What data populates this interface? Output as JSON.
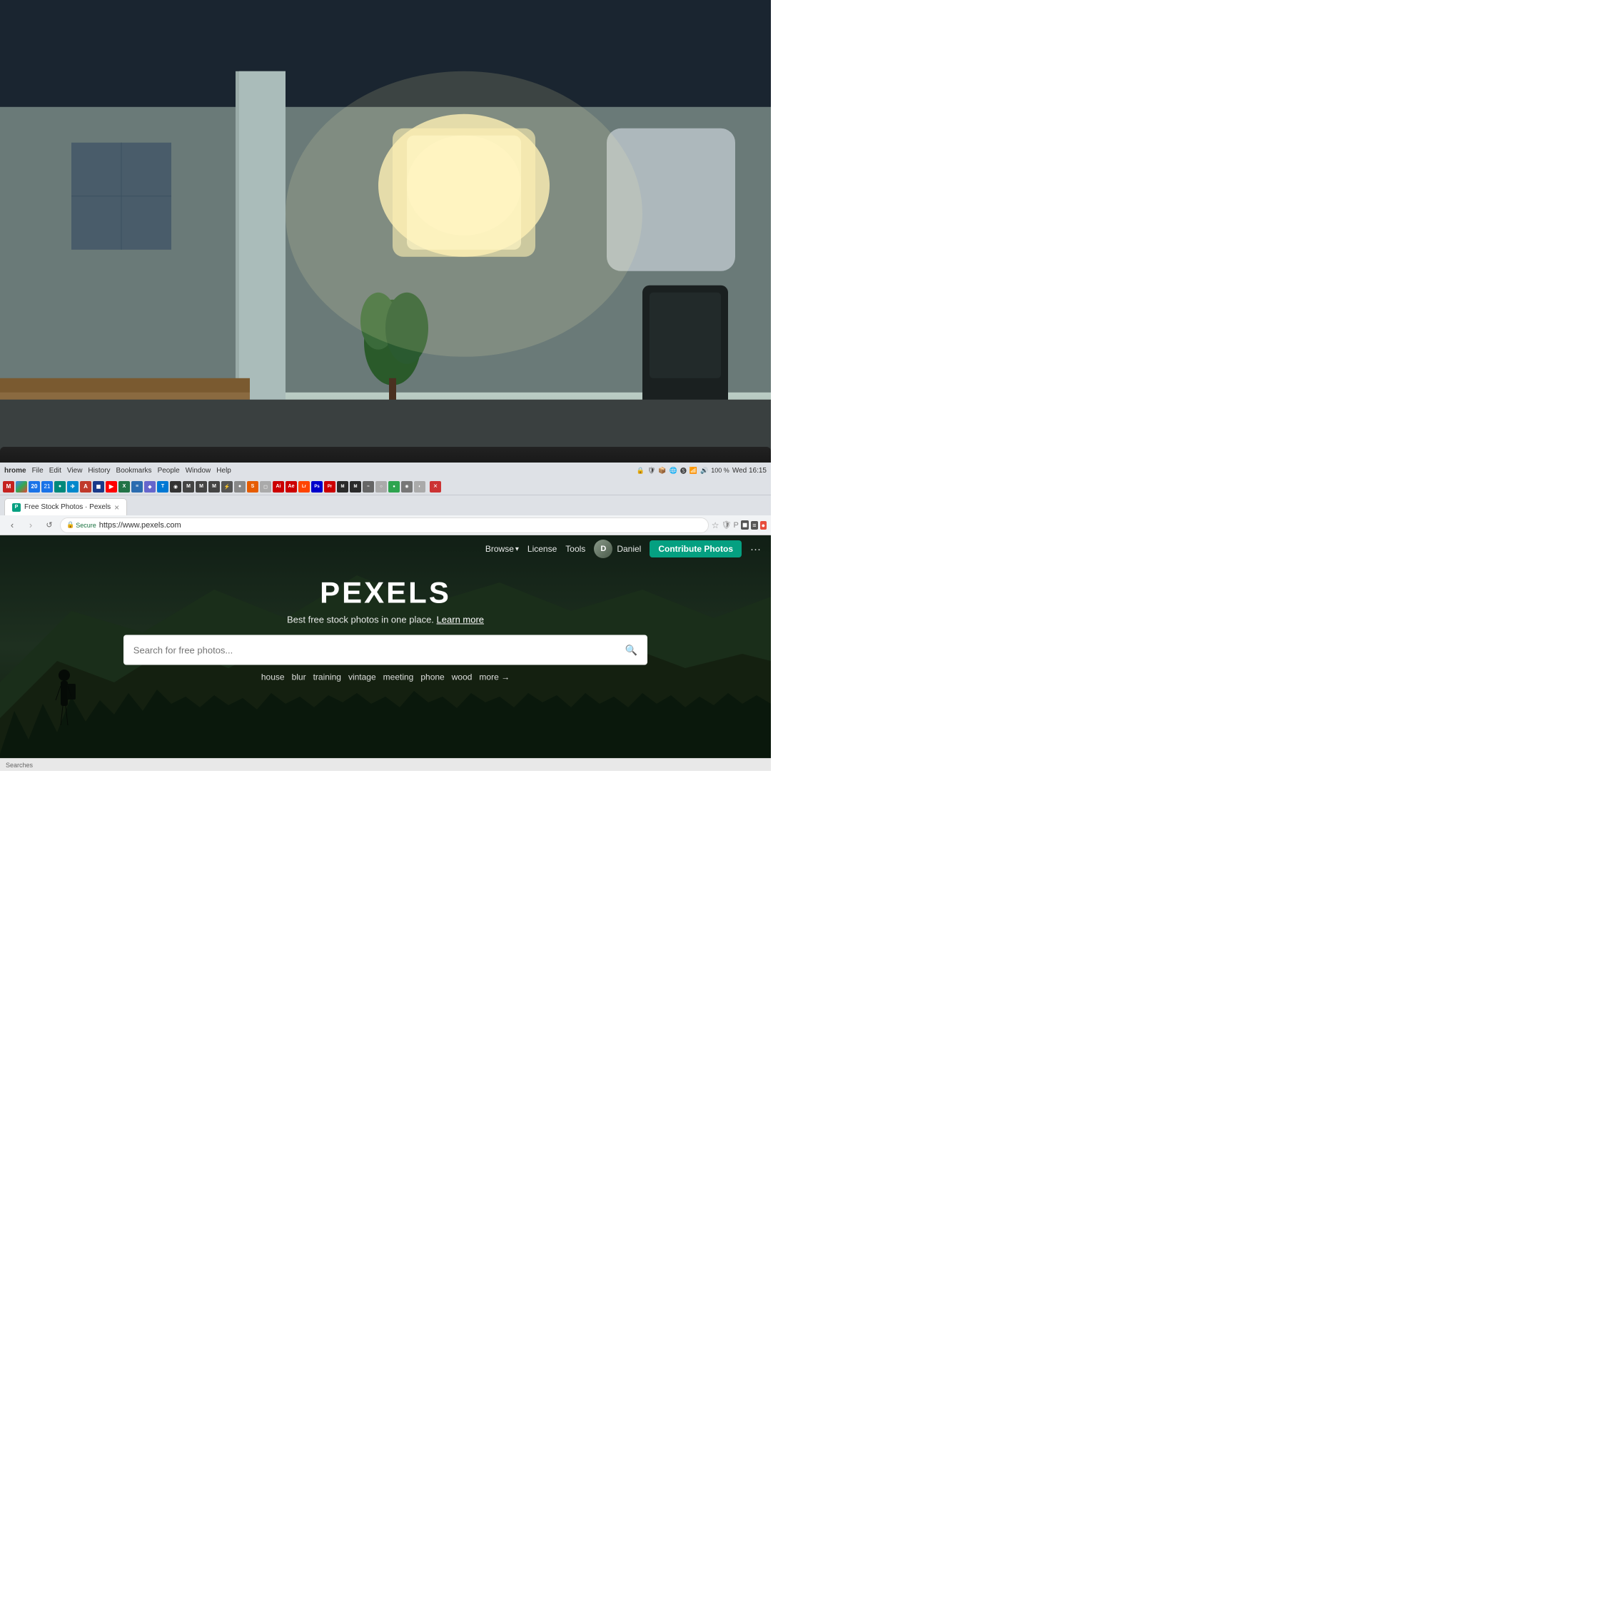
{
  "photo": {
    "alt": "Office workspace with blurred background"
  },
  "browser": {
    "menu": {
      "items": [
        "hrome",
        "File",
        "Edit",
        "View",
        "History",
        "Bookmarks",
        "People",
        "Window",
        "Help"
      ]
    },
    "system": {
      "battery": "100 %",
      "time": "Wed 16:15"
    },
    "tab": {
      "title": "Free Stock Photos · Pexels",
      "favicon": "P"
    },
    "address": {
      "secure_label": "Secure",
      "url": "https://www.pexels.com"
    },
    "close_icon": "×"
  },
  "pexels": {
    "nav": {
      "browse_label": "Browse",
      "license_label": "License",
      "tools_label": "Tools",
      "user_name": "Daniel",
      "contribute_label": "Contribute Photos",
      "more_icon": "···"
    },
    "hero": {
      "brand": "PEXELS",
      "subtitle": "Best free stock photos in one place.",
      "learn_more": "Learn more"
    },
    "search": {
      "placeholder": "Search for free photos...",
      "icon": "🔍"
    },
    "quick_tags": [
      {
        "label": "house"
      },
      {
        "label": "blur"
      },
      {
        "label": "training"
      },
      {
        "label": "vintage"
      },
      {
        "label": "meeting"
      },
      {
        "label": "phone"
      },
      {
        "label": "wood"
      },
      {
        "label": "more →"
      }
    ]
  },
  "taskbar": {
    "label": "Searches"
  },
  "colors": {
    "contribute_bg": "#05a081",
    "pexels_dark_bg": "#0d1510"
  }
}
